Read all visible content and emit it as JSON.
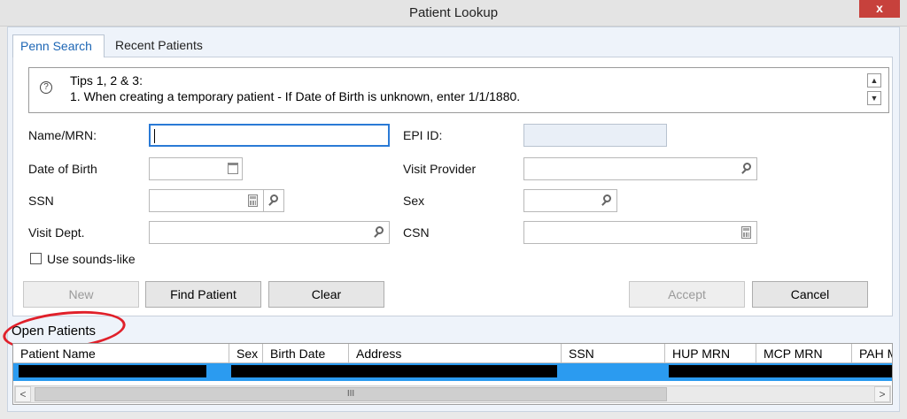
{
  "window": {
    "title": "Patient Lookup",
    "close_glyph": "x"
  },
  "tabs": [
    {
      "label": "Penn Search",
      "active": true
    },
    {
      "label": "Recent Patients",
      "active": false
    }
  ],
  "tips": {
    "heading": "Tips 1, 2 & 3:",
    "text": "1. When creating a temporary patient - If Date of Birth is unknown, enter 1/1/1880.",
    "icon": "question-icon"
  },
  "fields": {
    "name_mrn": {
      "label": "Name/MRN:",
      "value": ""
    },
    "epi_id": {
      "label": "EPI ID:",
      "value": ""
    },
    "dob": {
      "label": "Date of Birth",
      "value": ""
    },
    "visit_provider": {
      "label": "Visit Provider",
      "value": ""
    },
    "ssn": {
      "label": "SSN",
      "value": ""
    },
    "sex": {
      "label": "Sex",
      "value": ""
    },
    "visit_dept": {
      "label": "Visit Dept.",
      "value": ""
    },
    "csn": {
      "label": "CSN",
      "value": ""
    }
  },
  "sounds_like": {
    "label": "Use sounds-like",
    "checked": false
  },
  "buttons": {
    "new": "New",
    "find_patient": "Find Patient",
    "clear": "Clear",
    "accept": "Accept",
    "cancel": "Cancel"
  },
  "open_patients": {
    "label": "Open Patients",
    "columns": [
      "Patient Name",
      "Sex",
      "Birth Date",
      "Address",
      "SSN",
      "HUP MRN",
      "MCP MRN",
      "PAH M"
    ]
  },
  "scrollbar": {
    "left_arrow": "<",
    "right_arrow": ">",
    "thumb_grip": "III"
  },
  "colors": {
    "selection": "#2b9bf0",
    "focus_border": "#2a7ad6",
    "annotation_circle": "#e0202a",
    "close_button": "#c7413c"
  }
}
